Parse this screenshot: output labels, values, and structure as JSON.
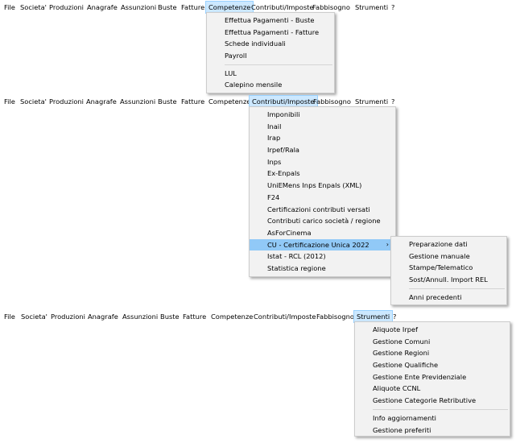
{
  "menubar": [
    "File",
    "Societa'",
    "Produzioni",
    "Anagrafe",
    "Assunzioni",
    "Buste",
    "Fatture",
    "Competenze",
    "Contributi/Imposte",
    "Fabbisogno",
    "Strumenti",
    "?"
  ],
  "competenze_menu": {
    "items": [
      "Effettua Pagamenti - Buste",
      "Effettua Pagamenti - Fatture",
      "Schede individuali",
      "Payroll"
    ],
    "items2": [
      "LUL",
      "Calepino mensile"
    ]
  },
  "contributi_menu": {
    "items": [
      "Imponibili",
      "Inail",
      "Irap",
      "Irpef/Rala",
      "Inps",
      "Ex-Enpals",
      "UniEMens Inps Enpals (XML)",
      "F24",
      "Certificazioni contributi versati",
      "Contributi carico società / regione",
      "AsForCinema",
      "CU - Certificazione Unica 2022",
      "Istat - RCL (2012)",
      "Statistica regione"
    ],
    "submenu_arrow": "›"
  },
  "cu_submenu": {
    "items": [
      "Preparazione dati",
      "Gestione manuale",
      "Stampe/Telematico",
      "Sost/Annull. Import REL"
    ],
    "items2": [
      "Anni precedenti"
    ]
  },
  "strumenti_menu": {
    "items": [
      "Aliquote Irpef",
      "Gestione Comuni",
      "Gestione Regioni",
      "Gestione Qualifiche",
      "Gestione Ente Previdenziale",
      "Aliquote CCNL",
      "Gestione Categorie Retributive"
    ],
    "items2": [
      "Info aggiornamenti",
      "Gestione preferiti"
    ]
  }
}
